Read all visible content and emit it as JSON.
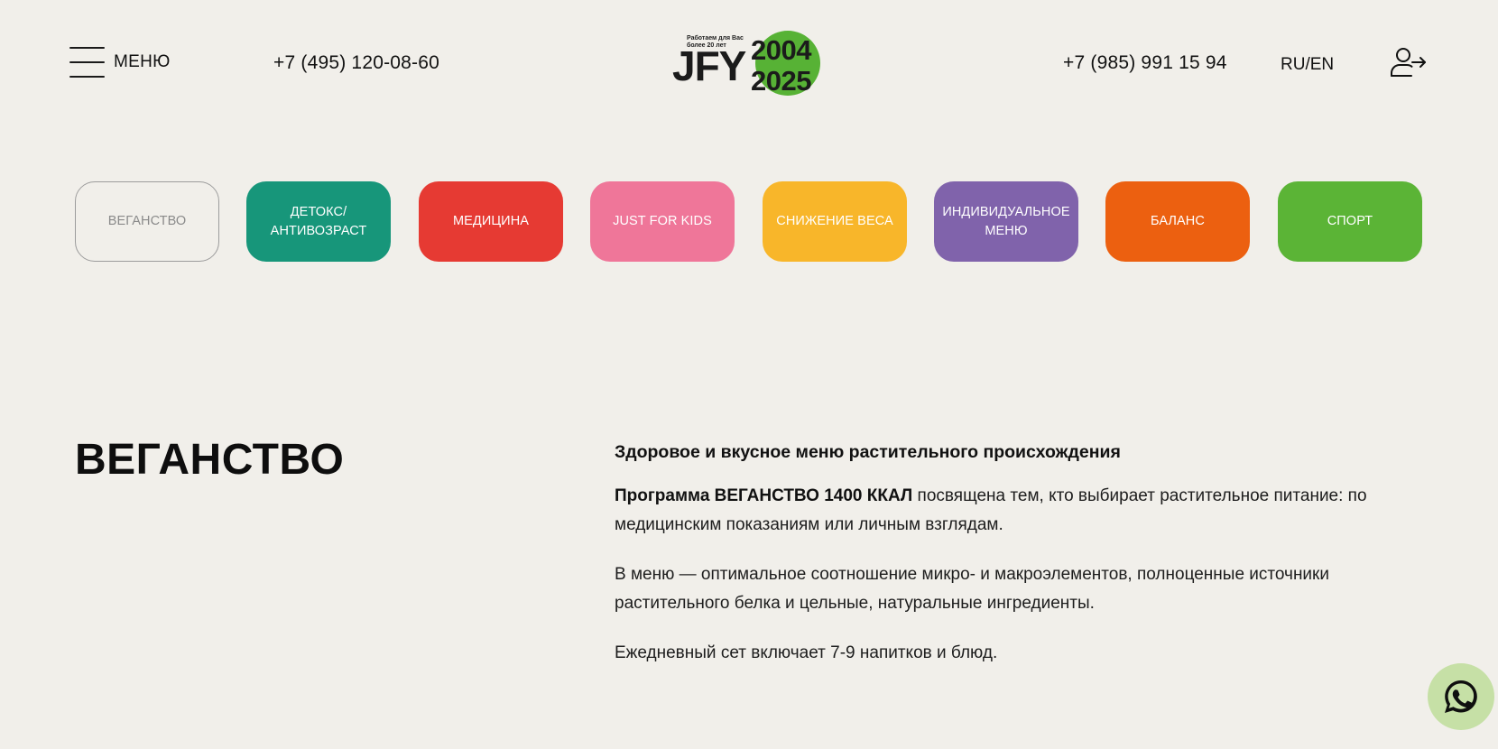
{
  "header": {
    "menu_label": "МЕНЮ",
    "phone_1": "+7 (495) 120-08-60",
    "phone_2": "+7 (985) 991 15 94",
    "lang": "RU/EN",
    "logo": {
      "tagline_line1": "Работаем для Вас",
      "tagline_line2": "более 20 лет",
      "word": "JFY",
      "year_start": "2004",
      "year_end": "2025",
      "circle_color": "#57b235"
    }
  },
  "programs": [
    {
      "label": "ВЕГАНСТВО",
      "color": "transparent",
      "active": true
    },
    {
      "label": "ДЕТОКС/ АНТИВОЗРАСТ",
      "color": "#17967a",
      "active": false
    },
    {
      "label": "МЕДИЦИНА",
      "color": "#e63a33",
      "active": false
    },
    {
      "label": "JUST FOR KIDS",
      "color": "#ef7699",
      "active": false
    },
    {
      "label": "СНИЖЕНИЕ ВЕСА",
      "color": "#f8b62a",
      "active": false
    },
    {
      "label": "ИНДИВИДУАЛЬНОЕ МЕНЮ",
      "color": "#8063ab",
      "active": false
    },
    {
      "label": "БАЛАНС",
      "color": "#ec6010",
      "active": false
    },
    {
      "label": "СПОРТ",
      "color": "#5bb436",
      "active": false
    }
  ],
  "content": {
    "title": "ВЕГАНСТВО",
    "subtitle": "Здоровое и вкусное меню растительного происхождения",
    "p1_bold": "Программа ВЕГАНСТВО 1400 ККАЛ",
    "p1_rest": " посвящена тем, кто выбирает растительное питание: по медицинским показаниям или личным взглядам.",
    "p2": "В меню — оптимальное соотношение микро- и макроэлементов, полноценные источники растительного белка и цельные, натуральные ингредиенты.",
    "p3": "Ежедневный сет включает 7-9 напитков и блюд."
  },
  "icons": {
    "menu": "hamburger-icon",
    "login": "user-login-icon",
    "whatsapp": "whatsapp-icon"
  },
  "colors": {
    "background": "#f1efea",
    "whatsapp_bg": "#c6e0a6"
  }
}
